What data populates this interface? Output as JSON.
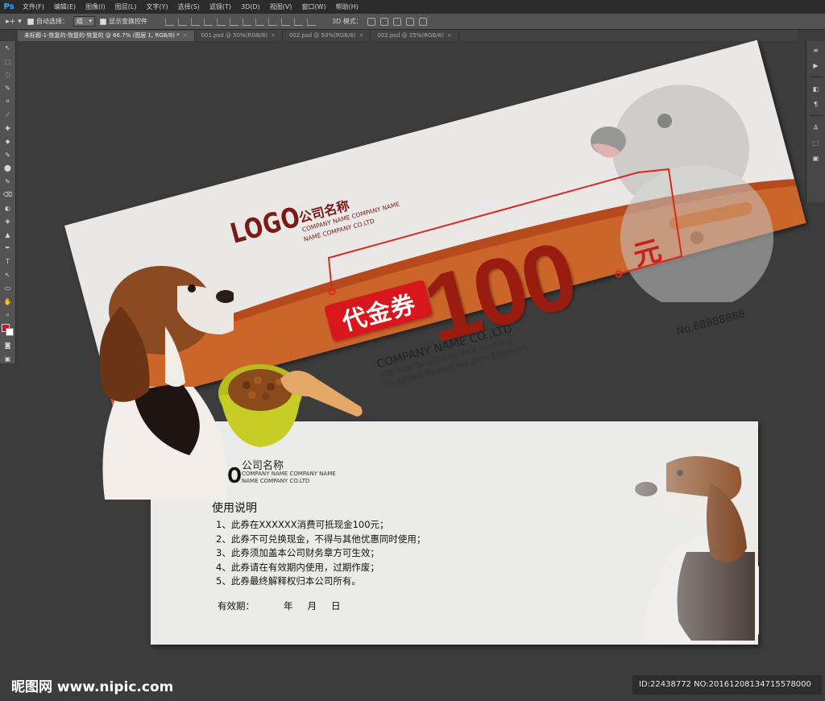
{
  "app": {
    "logo": "Ps",
    "menu": [
      "文件(F)",
      "编辑(E)",
      "图像(I)",
      "图层(L)",
      "文字(Y)",
      "选择(S)",
      "滤镜(T)",
      "3D(D)",
      "视图(V)",
      "窗口(W)",
      "帮助(H)"
    ]
  },
  "options": {
    "auto_select_label": "自动选择：",
    "auto_select_value": "组",
    "show_transform_label": "显示变换控件",
    "mode3d_label": "3D 模式："
  },
  "tabs": [
    {
      "label": "未标题-1-恢复的-恢复的-恢复的 @ 66.7% (图层 1, RGB/8) *",
      "active": true
    },
    {
      "label": "001.psd @ 50%(RGB/8)",
      "active": false
    },
    {
      "label": "002.psd @ 50%(RGB/8)",
      "active": false
    },
    {
      "label": "002.psd @ 25%(RGB/8)",
      "active": false
    }
  ],
  "tools": [
    "↖",
    "⬚",
    "◌",
    "✎",
    "⌗",
    "⟋",
    "✚",
    "⬥",
    "✎",
    "⬤",
    "✎",
    "⌫",
    "◐",
    "◈",
    "▲",
    "✒",
    "T",
    "↖",
    "▭",
    "✋",
    "⌕"
  ],
  "right_panel": [
    "≡",
    "▶",
    "◧",
    "¶",
    "A",
    "⬚",
    "▣"
  ],
  "colors": {
    "foreground": "#c8102e",
    "background": "#ffffff",
    "brand_red": "#d7171b",
    "dark_red": "#9a1b10",
    "orange": "#cf6a2c"
  },
  "front_ticket": {
    "logo": "LOGO",
    "company_cn": "公司名称",
    "company_en_line1": "COMPANY NAME COMPANY NAME",
    "company_en_line2": "NAME COMPANY CO.LTD",
    "amount": "100",
    "currency": "元",
    "voucher_label": "代金券",
    "company_full": "COMPANY NAME CO.,LTD",
    "address": "ADD:Now QingShanHu aroa.No.chang",
    "contact": "TEL:8888-88888888  FAX:8888-88888888",
    "number": "No.88888888"
  },
  "back_card": {
    "logo": "LOGO",
    "company_cn": "公司名称",
    "company_en_line1": "COMPANY NAME COMPANY NAME",
    "company_en_line2": "NAME COMPANY CO.LTD",
    "title": "使用说明",
    "rules": [
      "1、此券在XXXXXX消费可抵现金100元；",
      "2、此券不可兑换现金，不得与其他优惠同时使用；",
      "3、此券须加盖本公司财务章方可生效；",
      "4、此券请在有效期内使用，过期作废；",
      "5、此券最终解释权归本公司所有。"
    ],
    "valid_label": "有效期：",
    "year": "年",
    "month": "月",
    "day": "日"
  },
  "watermark": {
    "site": "昵图网 www.nipic.com",
    "id": "ID:22438772 NO:20161208134715578000"
  }
}
